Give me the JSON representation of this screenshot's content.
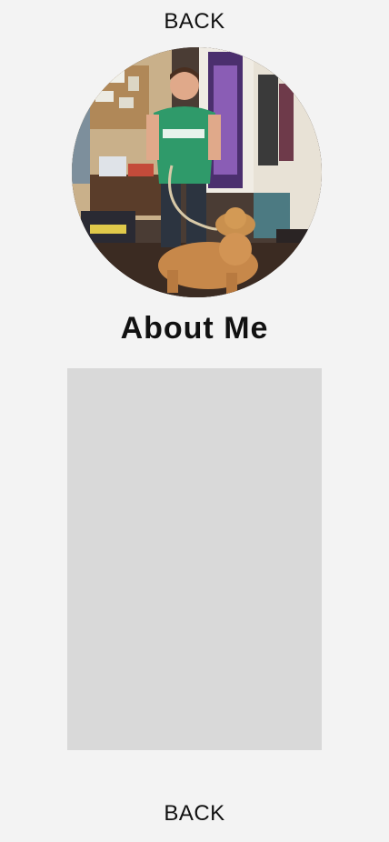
{
  "nav": {
    "back_top_label": "BACK",
    "back_bottom_label": "BACK"
  },
  "profile": {
    "photo_description": "profile-photo"
  },
  "about": {
    "title": "About Me"
  },
  "colors": {
    "background": "#f3f3f3",
    "content_placeholder": "#d9d9d9",
    "text": "#111111"
  }
}
